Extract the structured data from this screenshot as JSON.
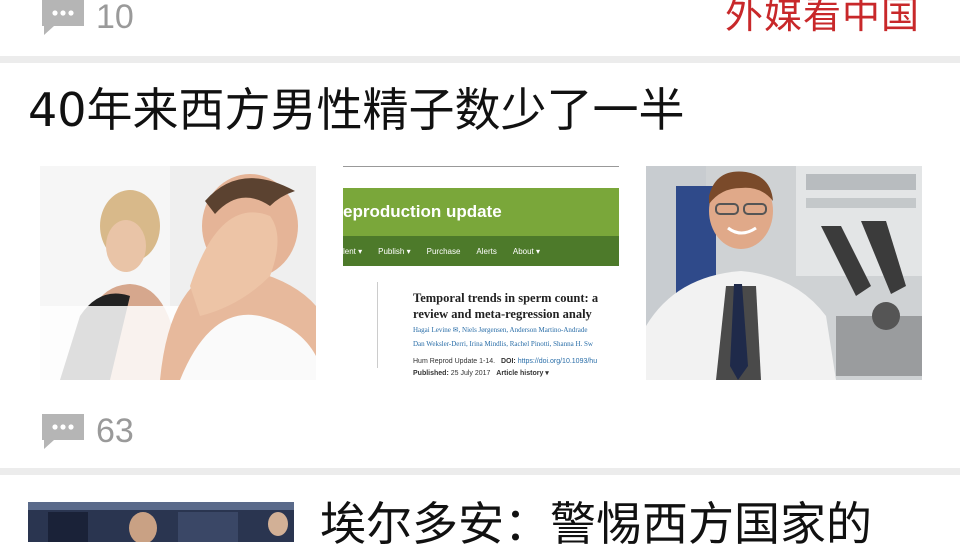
{
  "top_item": {
    "comment_count": "10",
    "tag": "外媒看中国"
  },
  "article": {
    "headline": "40年来西方男性精子数少了一半",
    "images": [
      {
        "description": "distressed-man-photo"
      },
      {
        "description": "journal-screenshot",
        "journal_title": "eproduction update",
        "nav": [
          "lent ▾",
          "Publish ▾",
          "Purchase",
          "Alerts",
          "About ▾"
        ],
        "article_title_1": "Temporal trends in sperm count: a",
        "article_title_2": "review and meta-regression analy",
        "authors_1": "Hagai Levine ✉, Niels Jørgensen, Anderson Martino-Andrade",
        "authors_2": "Dan Weksler-Derri, Irina Mindlis, Rachel Pinotti, Shanna H. Sw",
        "ref_1_label": "Hum Reprod Update",
        "ref_1_pages": "1-14.",
        "ref_doi_label": "DOI:",
        "ref_doi": "https://doi.org/10.1093/hu",
        "published_label": "Published:",
        "published_date": "25 July 2017",
        "article_history": "Article history ▾"
      },
      {
        "description": "researcher-portrait-photo"
      }
    ],
    "comment_count": "63"
  },
  "next_article": {
    "headline": "埃尔多安：警惕西方国家的"
  },
  "colors": {
    "tag_red": "#c8282a",
    "divider": "#ececec",
    "meta_grey": "#9a9a9a",
    "journal_green": "#7aa73a"
  }
}
